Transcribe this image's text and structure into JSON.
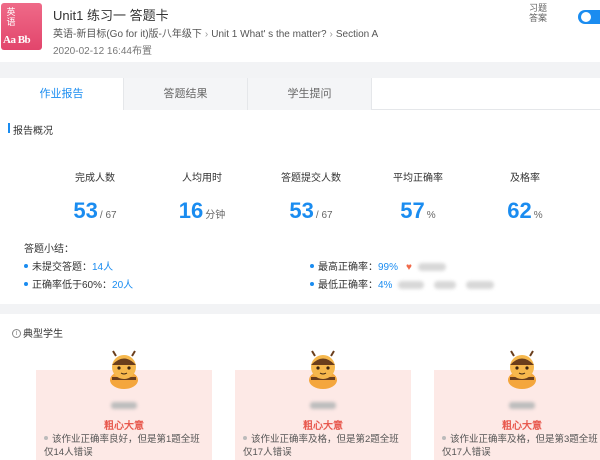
{
  "header": {
    "book_icon_top": "英语",
    "book_icon_bottom": "Aa Bb",
    "title": "Unit1 练习一 答题卡",
    "breadcrumb": [
      "英语-新目标(Go for it)版-八年级下",
      "Unit 1 What' s the matter?",
      "Section A"
    ],
    "date": "2020-02-12 16:44布置",
    "toggle_label": "习题答案",
    "toggle_on": true
  },
  "tabs": [
    {
      "label": "作业报告",
      "active": true
    },
    {
      "label": "答题结果",
      "active": false
    },
    {
      "label": "学生提问",
      "active": false
    }
  ],
  "report": {
    "title": "报告概况",
    "stats": [
      {
        "label": "完成人数",
        "value": "53",
        "unit": "/ 67"
      },
      {
        "label": "人均用时",
        "value": "16",
        "unit": "分钟"
      },
      {
        "label": "答题提交人数",
        "value": "53",
        "unit": "/ 67"
      },
      {
        "label": "平均正确率",
        "value": "57",
        "unit": "%"
      },
      {
        "label": "及格率",
        "value": "62",
        "unit": "%"
      }
    ],
    "summary_label": "答题小结：",
    "summary": {
      "unsubmitted_label": "未提交答题：",
      "unsubmitted_value": "14人",
      "below60_label": "正确率低于60%：",
      "below60_value": "20人",
      "highest_label": "最高正确率：",
      "highest_value": "99%",
      "lowest_label": "最低正确率：",
      "lowest_value": "4%"
    }
  },
  "typical": {
    "title": "典型学生",
    "students": [
      {
        "type": "粗心大意",
        "desc": "该作业正确率良好，但是第1题全班仅14人错误"
      },
      {
        "type": "粗心大意",
        "desc": "该作业正确率及格，但是第2题全班仅17人错误"
      },
      {
        "type": "粗心大意",
        "desc": "该作业正确率及格，但是第3题全班仅17人错误"
      }
    ]
  },
  "colors": {
    "accent": "#1a8cf0",
    "student_card": "#fde9e6",
    "student_type": "#e85a4f"
  }
}
